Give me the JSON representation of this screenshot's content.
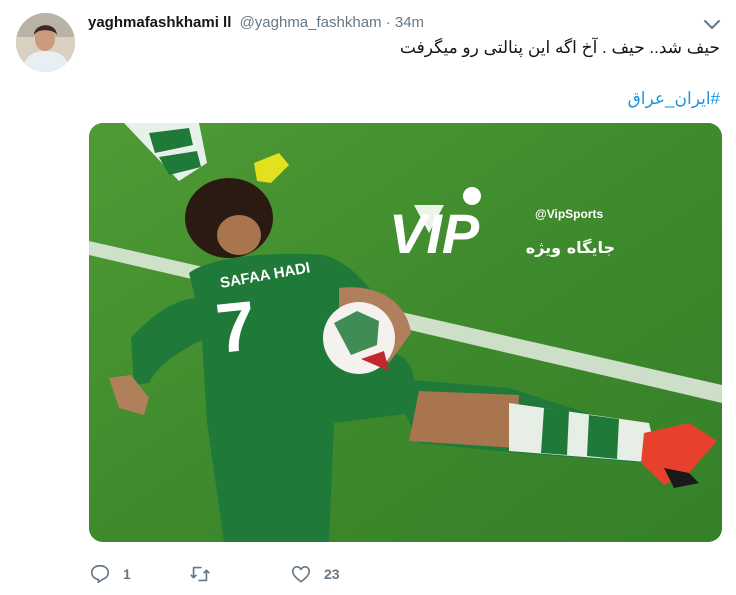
{
  "user": {
    "display_name": "yaghmafashkhami ll",
    "handle": "@yaghma_fashkham",
    "separator": "·",
    "time": "34m"
  },
  "tweet": {
    "text": "حیف شد.. حیف . آخ اگه این پنالتی رو میگرفت",
    "hashtag": "#ایران_عراق"
  },
  "media": {
    "watermark_brand": "VIP",
    "watermark_handle": "@VipSports",
    "watermark_subtitle": "جایگاه ویژه",
    "jersey_name": "SAFAA HADI",
    "jersey_number": "7"
  },
  "actions": {
    "reply_count": "1",
    "retweet_count": "",
    "like_count": "23"
  },
  "icons": {
    "caret": "chevron-down-icon",
    "reply": "reply-icon",
    "retweet": "retweet-icon",
    "like": "heart-icon"
  },
  "colors": {
    "link": "#1b95e0",
    "secondary_text": "#657786",
    "primary_text": "#14171a",
    "pitch_green": "#3f8a2c",
    "jersey_green": "#1f7a3a"
  }
}
